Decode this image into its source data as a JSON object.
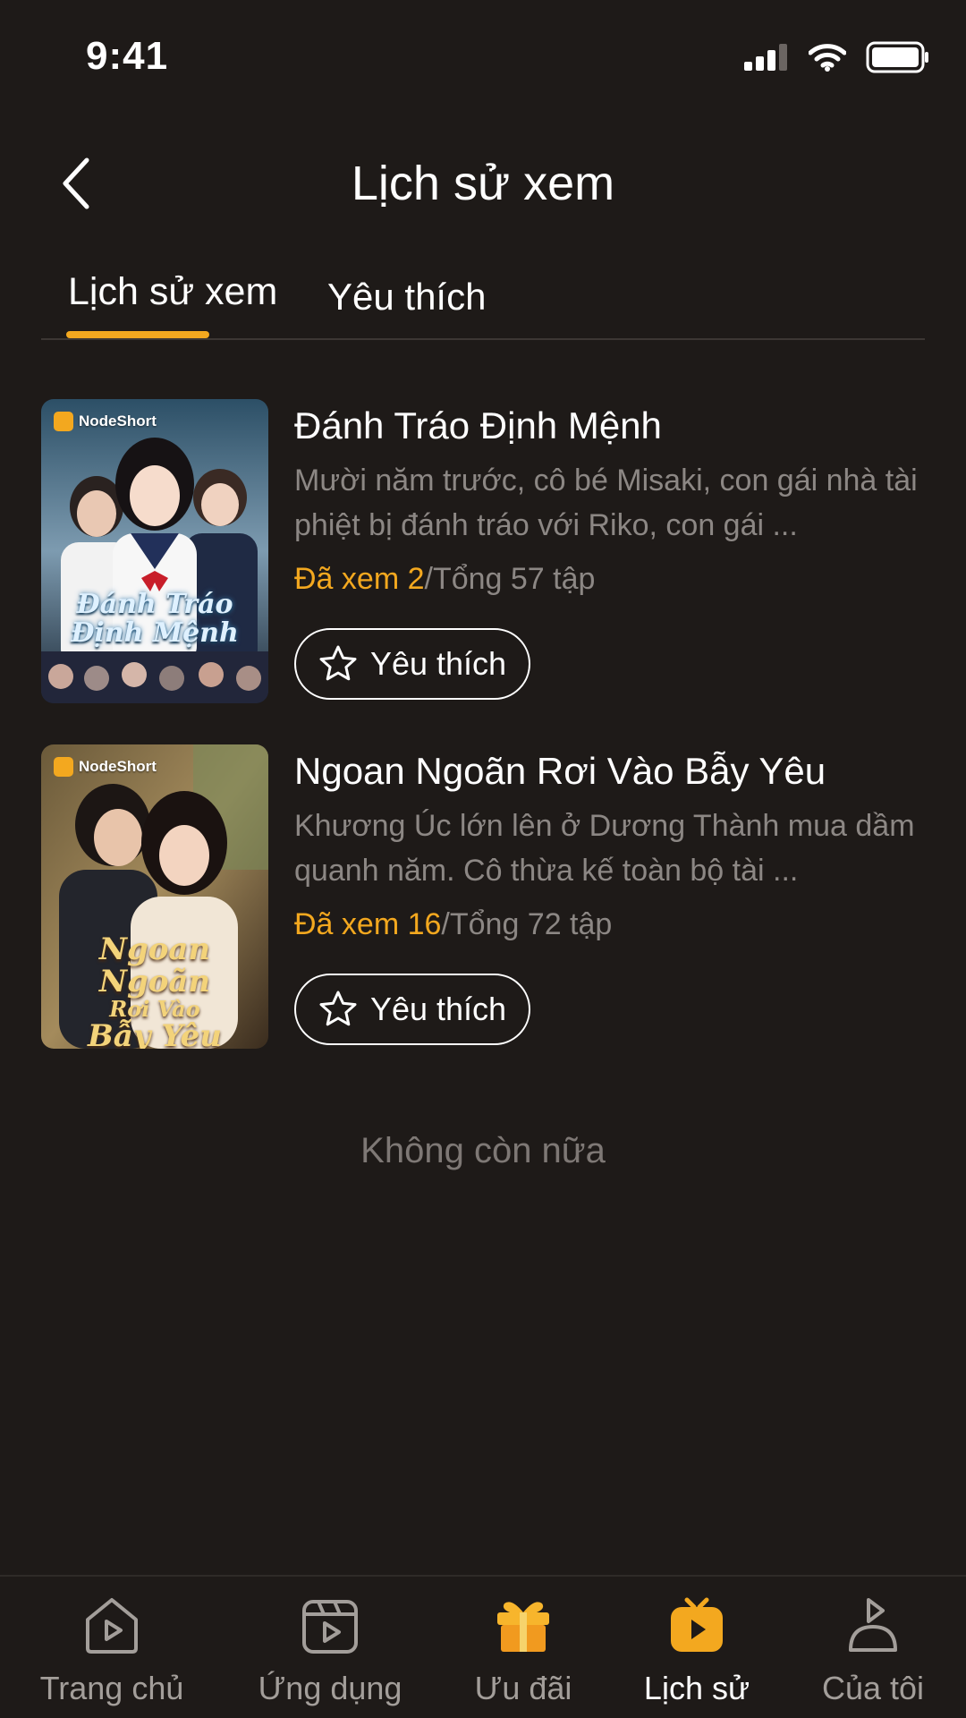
{
  "status_bar": {
    "time": "9:41"
  },
  "header": {
    "title": "Lịch sử xem"
  },
  "tabs": [
    {
      "label": "Lịch sử xem",
      "active": true
    },
    {
      "label": "Yêu thích",
      "active": false
    }
  ],
  "items": [
    {
      "poster_brand": "NodeShort",
      "poster_title_line1": "Đánh Tráo",
      "poster_title_line2": "Định Mệnh",
      "title": "Đánh Tráo Định Mệnh",
      "description": "Mười năm trước, cô bé Misaki, con gái nhà tài phiệt bị đánh tráo với Riko, con gái ...",
      "watched": "Đã xem 2",
      "total": "/Tổng 57 tập",
      "favorite_label": "Yêu thích"
    },
    {
      "poster_brand": "NodeShort",
      "poster_title_line1": "Ngoan Ngoãn",
      "poster_title_line2": "Rơi Vào",
      "poster_title_line3": "Bẫy Yêu",
      "title": "Ngoan Ngoãn Rơi Vào Bẫy Yêu",
      "description": "Khương Úc lớn lên ở Dương Thành mua dầm quanh năm. Cô thừa kế toàn bộ tài  ...",
      "watched": "Đã xem 16",
      "total": "/Tổng 72 tập",
      "favorite_label": "Yêu thích"
    }
  ],
  "end_text": "Không còn nữa",
  "bottom_nav": [
    {
      "label": "Trang chủ",
      "icon": "home-play-icon"
    },
    {
      "label": "Ứng dụng",
      "icon": "clapperboard-icon"
    },
    {
      "label": "Ưu đãi",
      "icon": "gift-icon"
    },
    {
      "label": "Lịch sử",
      "icon": "tv-play-icon",
      "active": true
    },
    {
      "label": "Của tôi",
      "icon": "profile-icon"
    }
  ],
  "colors": {
    "background": "#1e1a18",
    "accent": "#f3a81f",
    "muted_text": "#8c8784"
  }
}
